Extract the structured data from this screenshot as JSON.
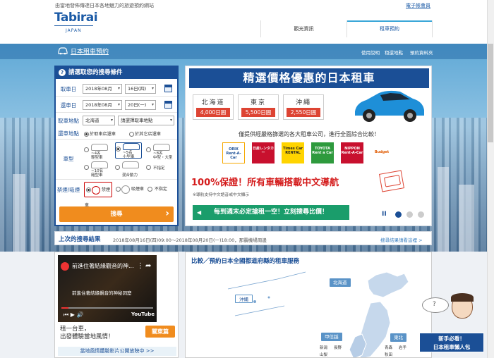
{
  "header": {
    "tagline": "由當地發佈傳達日本各地魅力的旅遊預約網站",
    "logo": "Tabirai",
    "logo_sub": "JAPAN",
    "ebook": "電子帳會員",
    "tabs": [
      {
        "label": "觀光資訊"
      },
      {
        "label": "租車預約"
      }
    ]
  },
  "subheader": {
    "title": "日本租車預約",
    "links": [
      {
        "label": "使用說明"
      },
      {
        "label": "租還地點"
      },
      {
        "label": "預約資料夾"
      }
    ]
  },
  "search": {
    "title": "請選取您的搜尋條件",
    "pickup_label": "取車日",
    "pickup_month": "2018年08月",
    "pickup_day": "16日(四)",
    "pickup_time": "09:00",
    "return_label": "還車日",
    "return_month": "2018年08月",
    "return_day": "20日(一)",
    "return_time": "18:00",
    "area_label": "取車地點",
    "area_pref": "北海道",
    "area_place": "請選擇取車地點",
    "return_area_label": "還車地點",
    "same_place": "於取車店還車",
    "other_place": "於其它店還車",
    "cartype_label": "車型",
    "cartypes": [
      {
        "name": "輕型車",
        "cap": "~4名"
      },
      {
        "name": "小型車",
        "cap": "~5名"
      },
      {
        "name": "中型・大型",
        "cap": "~8名"
      },
      {
        "name": "廂型車",
        "cap": "~10名"
      },
      {
        "name": "混合動力",
        "cap": ""
      },
      {
        "name": "不指定",
        "cap": ""
      }
    ],
    "smoke_label": "禁煙/吸煙",
    "smoke_options": [
      {
        "label": "禁煙車"
      },
      {
        "label": "吸煙車"
      },
      {
        "label": "不指定"
      }
    ],
    "search_button": "搜尋"
  },
  "banner": {
    "title": "精選價格優惠的日本租車",
    "areas": [
      {
        "name": "北海道",
        "price": "4,000日圓"
      },
      {
        "name": "東京",
        "price": "5,500日圓"
      },
      {
        "name": "沖繩",
        "price": "2,550日圓"
      }
    ],
    "desc": "僅提供經嚴格篩選的各大租車公司，進行全面綜合比較！",
    "brands": [
      {
        "name": "ORIX Rent-A-Car",
        "color": "#f6a800"
      },
      {
        "name": "日産レンタカー",
        "color": "#c8102e"
      },
      {
        "name": "Times Car RENTAL",
        "color": "#ffd400"
      },
      {
        "name": "TOYOTA Rent a Car",
        "color": "#2e9a3d"
      },
      {
        "name": "NIPPON Rent-A-Car",
        "color": "#c8102e"
      },
      {
        "name": "Budget",
        "color": "#ffffff"
      }
    ],
    "guarantee": "100%保證！所有車輛搭載中文導航",
    "note": "※導航支持中文語音或中文顯示",
    "promo": "每到週末必定搶租一空！立刻搜尋比價！",
    "pause": "II"
  },
  "history": {
    "title": "上次的搜尋結果",
    "content": "2018年08月16日(四)09:00～2018年08月20日(一)18:00，那霸機場周邊",
    "more": "搜尋結果請看這裡 >"
  },
  "video": {
    "title": "前進住著結緣觀音的神...",
    "subtitle": "前進住著結緣觀音的神秘洞窟",
    "youtube": "YouTube",
    "text1": "租一台車，",
    "text2": "出發體驗當地風情！",
    "button": "關東篇",
    "footer": "當地風情體驗影片公開放映中 >>"
  },
  "map": {
    "title": "比較／預約日本全國都道府縣的租車服務",
    "regions": [
      {
        "name": "北海道"
      },
      {
        "name": "沖縄"
      },
      {
        "name": "甲信越"
      },
      {
        "name": "東北"
      }
    ],
    "prefectures": [
      "新潟",
      "長野",
      "山梨",
      "青森",
      "岩手",
      "秋田"
    ]
  },
  "helper": {
    "line1": "新手必看！",
    "line2": "日本租車懶人包"
  },
  "colors": {
    "brand_blue": "#1b4f96",
    "orange": "#f08c1e",
    "green": "#1a9d6b",
    "red": "#d41b1b"
  }
}
